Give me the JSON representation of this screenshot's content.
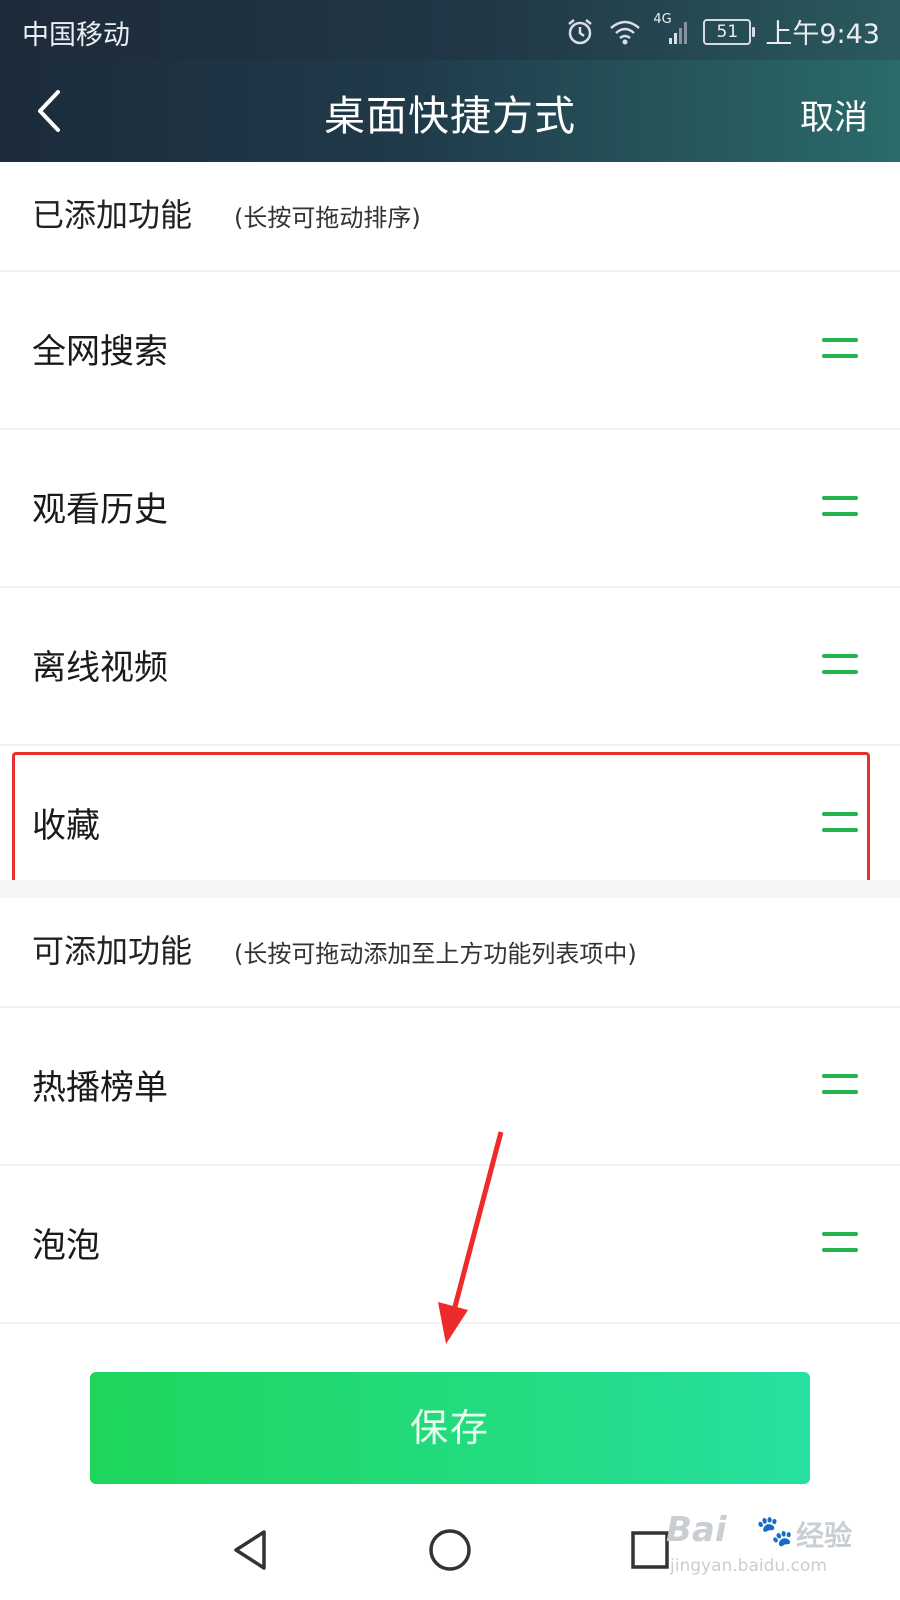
{
  "status_bar": {
    "carrier": "中国移动",
    "network": "4G",
    "battery": "51",
    "time": "上午9:43"
  },
  "header": {
    "back_icon": "chevron-left-icon",
    "title": "桌面快捷方式",
    "cancel_label": "取消"
  },
  "added_section": {
    "title": "已添加功能",
    "hint": "(长按可拖动排序)",
    "items": [
      {
        "label": "全网搜索",
        "handle_icon": "drag-handle-icon"
      },
      {
        "label": "观看历史",
        "handle_icon": "drag-handle-icon"
      },
      {
        "label": "离线视频",
        "handle_icon": "drag-handle-icon"
      },
      {
        "label": "收藏",
        "handle_icon": "drag-handle-icon",
        "highlighted": true
      }
    ]
  },
  "available_section": {
    "title": "可添加功能",
    "hint": "(长按可拖动添加至上方功能列表项中)",
    "items": [
      {
        "label": "热播榜单",
        "handle_icon": "drag-handle-icon"
      },
      {
        "label": "泡泡",
        "handle_icon": "drag-handle-icon"
      }
    ]
  },
  "save_button": {
    "label": "保存"
  },
  "system_nav": {
    "back_icon": "triangle-back-icon",
    "home_icon": "circle-home-icon",
    "recents_icon": "square-recents-icon"
  },
  "watermark": {
    "brand": "Bai",
    "suffix": "经验",
    "url": "jingyan.baidu.com"
  },
  "colors": {
    "accent_green": "#22b54a",
    "save_button_start": "#1fd55c",
    "save_button_end": "#26e0a0",
    "header_bg": "#1c2b3b",
    "highlight_red": "#e6302d"
  }
}
